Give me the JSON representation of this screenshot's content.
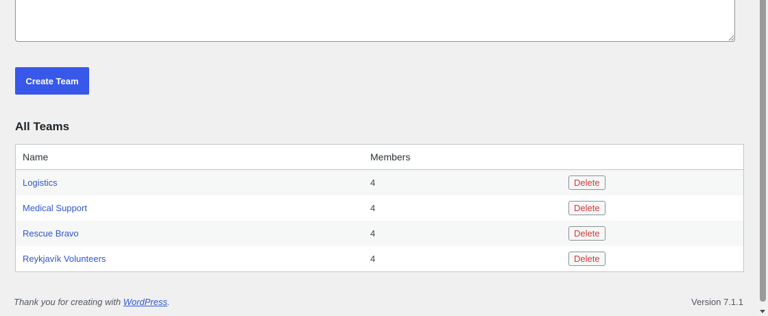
{
  "form": {
    "description_value": "",
    "create_button_label": "Create Team"
  },
  "teams_section": {
    "title": "All Teams",
    "columns": {
      "name": "Name",
      "members": "Members",
      "actions": ""
    },
    "rows": [
      {
        "name": "Logistics",
        "members": "4",
        "action_label": "Delete"
      },
      {
        "name": "Medical Support",
        "members": "4",
        "action_label": "Delete"
      },
      {
        "name": "Rescue Bravo",
        "members": "4",
        "action_label": "Delete"
      },
      {
        "name": "Reykjavík Volunteers",
        "members": "4",
        "action_label": "Delete"
      }
    ]
  },
  "footer": {
    "thanks_prefix": "Thank you for creating with ",
    "thanks_link": "WordPress",
    "thanks_suffix": ".",
    "version": "Version 7.1.1"
  },
  "colors": {
    "primary_button": "#3858e9",
    "link": "#2f55d4",
    "delete_text": "#d63638",
    "page_background": "#f0f0f1"
  },
  "icons": {
    "resize_handle": "textarea-resize-handle-icon",
    "scroll_down": "chevron-down-icon"
  }
}
